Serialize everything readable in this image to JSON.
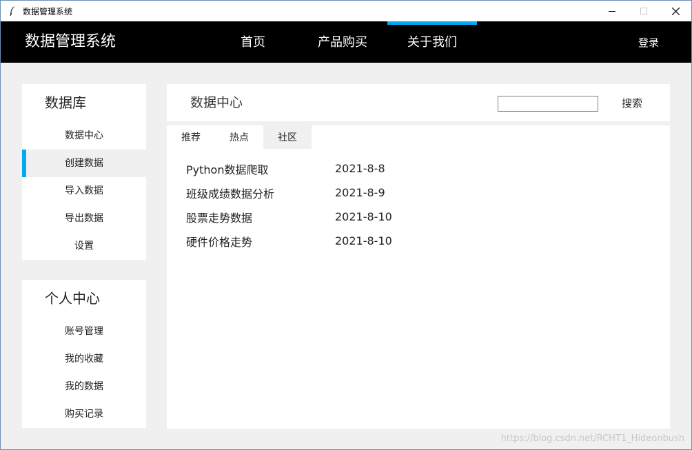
{
  "window": {
    "title": "数据管理系统"
  },
  "topnav": {
    "brand": "数据管理系统",
    "items": [
      {
        "label": "首页"
      },
      {
        "label": "产品购买"
      },
      {
        "label": "关于我们"
      }
    ],
    "active_index": 2,
    "login_label": "登录",
    "accent_color": "#00aaee"
  },
  "sidebar": {
    "database": {
      "title": "数据库",
      "items": [
        {
          "label": "数据中心"
        },
        {
          "label": "创建数据"
        },
        {
          "label": "导入数据"
        },
        {
          "label": "导出数据"
        },
        {
          "label": "设置"
        }
      ],
      "active_index": 1
    },
    "personal": {
      "title": "个人中心",
      "items": [
        {
          "label": "账号管理"
        },
        {
          "label": "我的收藏"
        },
        {
          "label": "我的数据"
        },
        {
          "label": "购买记录"
        }
      ]
    }
  },
  "main": {
    "title": "数据中心",
    "search": {
      "value": "",
      "button_label": "搜索"
    },
    "tabs": [
      {
        "label": "推荐"
      },
      {
        "label": "热点"
      },
      {
        "label": "社区"
      }
    ],
    "active_tab": 2,
    "rows": [
      {
        "title": "Python数据爬取",
        "date": "2021-8-8"
      },
      {
        "title": "班级成绩数据分析",
        "date": "2021-8-9"
      },
      {
        "title": "股票走势数据",
        "date": "2021-8-10"
      },
      {
        "title": "硬件价格走势",
        "date": "2021-8-10"
      }
    ]
  },
  "watermark": "https://blog.csdn.net/RCHT1_Hideonbush",
  "icons": {
    "app": "feather-icon",
    "minimize": "minimize-icon",
    "maximize": "maximize-icon",
    "close": "close-icon"
  }
}
